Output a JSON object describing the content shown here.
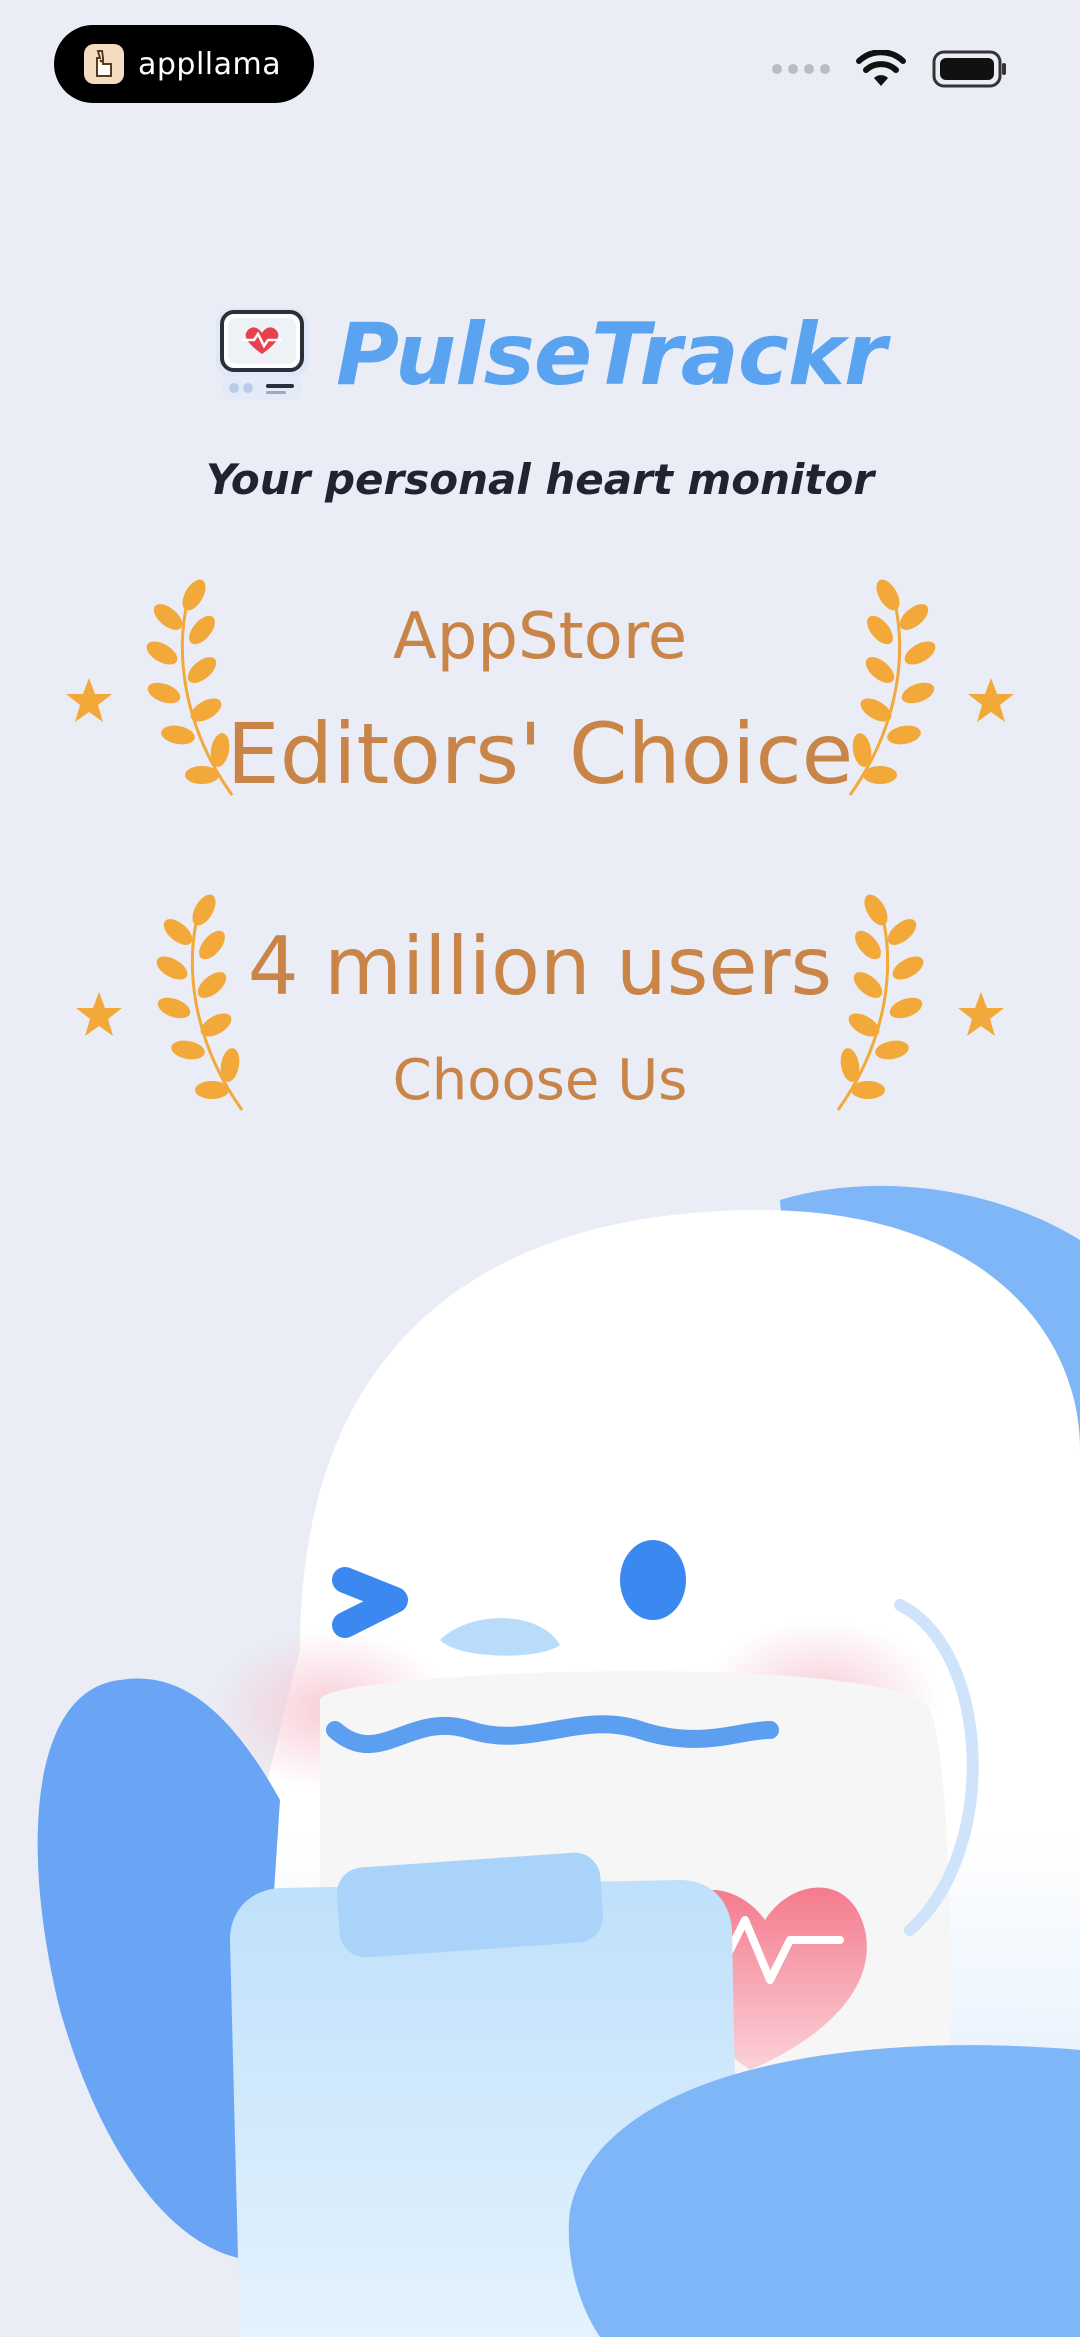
{
  "status_bar": {
    "badge_label": "appllama",
    "icons": [
      "signal-dots-icon",
      "wifi-icon",
      "battery-icon"
    ]
  },
  "header": {
    "app_name": "PulseTrackr",
    "tagline": "Your personal heart monitor",
    "icon": "heart-monitor-icon"
  },
  "awards": {
    "award1_line1": "AppStore",
    "award1_line2": "Editors' Choice",
    "award2_line1": "4 million users",
    "award2_line2": "Choose Us"
  },
  "colors": {
    "background": "#eaedf5",
    "brand_blue": "#5aa3f0",
    "award_orange": "#c98447",
    "laurel_gold": "#f3a83a"
  }
}
